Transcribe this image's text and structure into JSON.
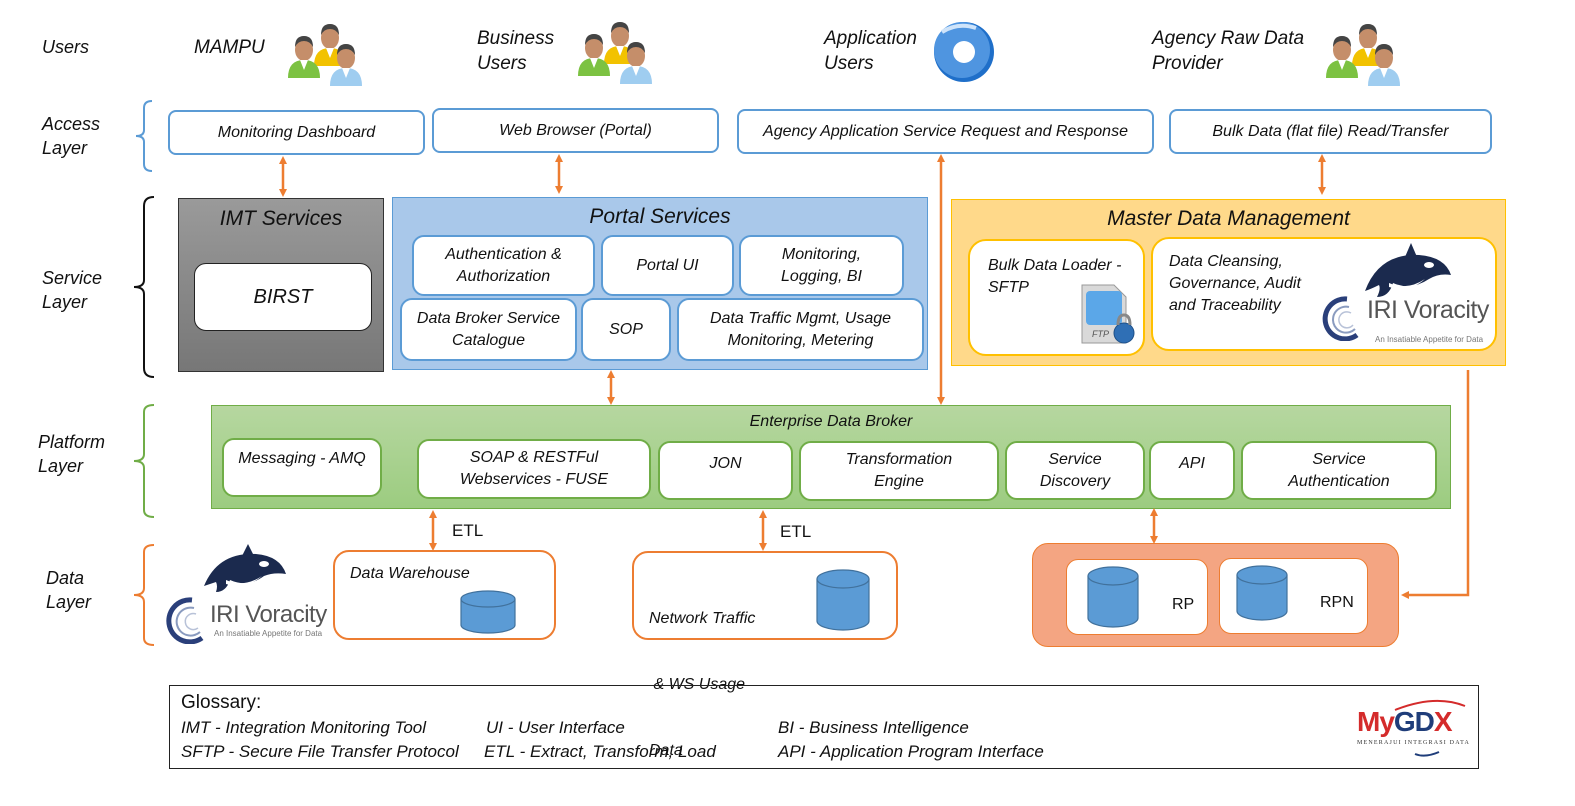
{
  "layers": {
    "users": "Users",
    "access": [
      "Access",
      "Layer"
    ],
    "service": [
      "Service",
      "Layer"
    ],
    "platform": [
      "Platform",
      "Layer"
    ],
    "data": [
      "Data",
      "Layer"
    ]
  },
  "users": [
    {
      "label": [
        "MAMPU"
      ],
      "icon": "users-group-icon"
    },
    {
      "label": [
        "Business",
        "Users"
      ],
      "icon": "users-group-icon"
    },
    {
      "label": [
        "Application",
        "Users"
      ],
      "icon": "application-disc-icon"
    },
    {
      "label": [
        "Agency Raw Data",
        "Provider"
      ],
      "icon": "users-group-icon"
    }
  ],
  "access": [
    "Monitoring Dashboard",
    "Web Browser (Portal)",
    "Agency Application Service Request and Response",
    "Bulk Data (flat file) Read/Transfer"
  ],
  "imt": {
    "title": "IMT Services",
    "item": "BIRST"
  },
  "portal": {
    "title": "Portal Services",
    "row1": [
      [
        "Authentication &",
        "Authorization"
      ],
      [
        "Portal UI"
      ],
      [
        "Monitoring,",
        "Logging, BI"
      ]
    ],
    "row2": [
      [
        "Data Broker Service",
        "Catalogue"
      ],
      [
        "SOP"
      ],
      [
        "Data Traffic Mgmt, Usage",
        "Monitoring, Metering"
      ]
    ]
  },
  "mdm": {
    "title": "Master Data Management",
    "loader": [
      "Bulk Data Loader -",
      "SFTP"
    ],
    "ftp_label": "FTP",
    "cleansing": [
      "Data Cleansing,",
      "Governance, Audit",
      "and Traceability"
    ],
    "voracity": {
      "name": "IRI Voracity",
      "tagline": "An Insatiable Appetite for Data"
    }
  },
  "edb": {
    "title": "Enterprise Data Broker",
    "items": [
      [
        "Messaging - AMQ"
      ],
      [
        "SOAP & RESTFul",
        "Webservices - FUSE"
      ],
      [
        "JON"
      ],
      [
        "Transformation",
        "Engine"
      ],
      [
        "Service",
        "Discovery"
      ],
      [
        "API"
      ],
      [
        "Service",
        "Authentication"
      ]
    ]
  },
  "data": {
    "voracity": {
      "name": "IRI Voracity",
      "tagline": "An Insatiable Appetite for Data"
    },
    "etl_label": "ETL",
    "warehouse": "Data Warehouse",
    "network": [
      "Network Traffic",
      " & WS Usage",
      "Data"
    ],
    "rp": "RP",
    "rpn": "RPN"
  },
  "glossary": {
    "title": "Glossary:",
    "rows": [
      [
        "IMT - Integration Monitoring Tool",
        "UI - User Interface",
        "BI - Business Intelligence"
      ],
      [
        "SFTP - Secure File Transfer Protocol",
        "ETL - Extract, Transform, Load",
        "API - Application Program Interface"
      ]
    ],
    "logo": {
      "name": "MyGDX",
      "tagline": "MENERAJUI INTEGRASI DATA"
    }
  },
  "colors": {
    "arrow": "#ed7d31",
    "access_border": "#5b9bd5",
    "imt_fill": "#8c8c8c",
    "portal_fill": "#a9c8ea",
    "mdm_fill": "#ffd98a",
    "edb_fill": "#a9d08e",
    "data_fill": "#f4a582",
    "cylinder": "#5b9bd5"
  }
}
